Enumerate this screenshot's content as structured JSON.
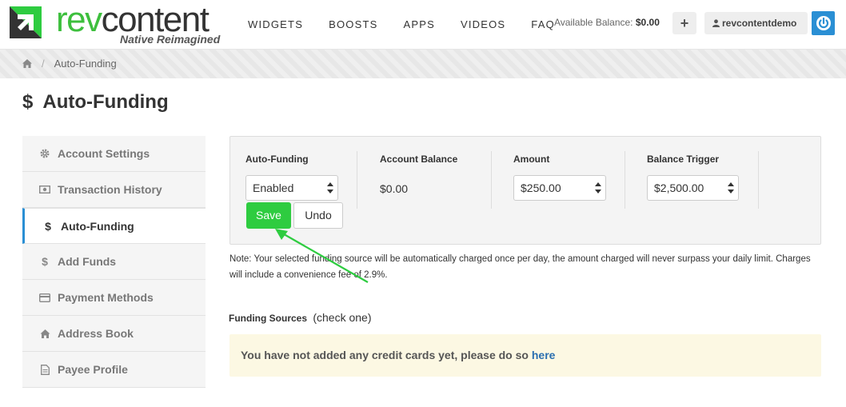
{
  "header": {
    "logo_rev": "rev",
    "logo_content": "content",
    "logo_tagline": "Native Reimagined",
    "nav": [
      "WIDGETS",
      "BOOSTS",
      "APPS",
      "VIDEOS",
      "FAQ"
    ],
    "balance_label": "Available Balance:",
    "balance_value": "$0.00",
    "plus_label": "+",
    "username": "revcontentdemo"
  },
  "breadcrumb": {
    "current": "Auto-Funding"
  },
  "page": {
    "title": "Auto-Funding",
    "title_icon": "$"
  },
  "sidebar": {
    "items": [
      {
        "label": "Account Settings",
        "icon": "gear-icon"
      },
      {
        "label": "Transaction History",
        "icon": "money-icon"
      },
      {
        "label": "Auto-Funding",
        "icon": "dollar-icon",
        "active": true
      },
      {
        "label": "Add Funds",
        "icon": "dollar-icon"
      },
      {
        "label": "Payment Methods",
        "icon": "credit-card-icon"
      },
      {
        "label": "Address Book",
        "icon": "home-icon"
      },
      {
        "label": "Payee Profile",
        "icon": "document-icon"
      }
    ]
  },
  "form": {
    "auto_funding_label": "Auto-Funding",
    "auto_funding_value": "Enabled",
    "account_balance_label": "Account Balance",
    "account_balance_value": "$0.00",
    "amount_label": "Amount",
    "amount_value": "$250.00",
    "trigger_label": "Balance Trigger",
    "trigger_value": "$2,500.00",
    "save_label": "Save",
    "undo_label": "Undo"
  },
  "note": "Note: Your selected funding source will be automatically charged once per day, the amount charged will never surpass your daily limit. Charges will include a convenience fee of 2.9%.",
  "funding": {
    "title": "Funding Sources",
    "subtitle": "(check one)",
    "alert_text": "You have not added any credit cards yet, please do so",
    "alert_link": "here"
  },
  "colors": {
    "brand_green": "#3dbf3d",
    "save_green": "#2ecc40",
    "accent_blue": "#2a8fd4",
    "alert_bg": "#fcf8e3"
  }
}
